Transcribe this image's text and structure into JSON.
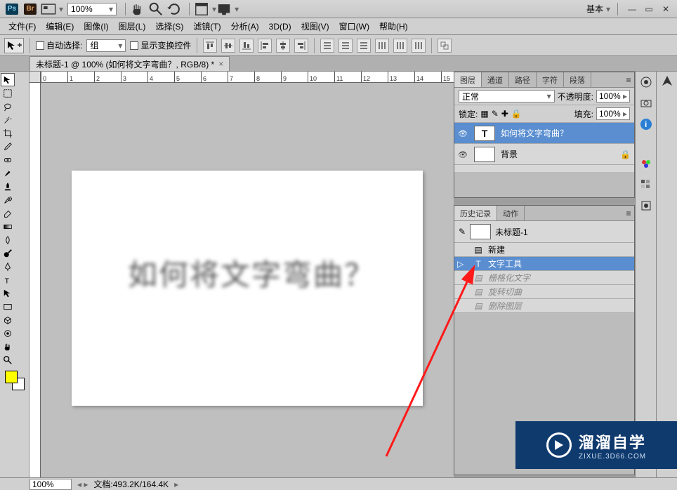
{
  "titlebar": {
    "zoom": "100%",
    "workspace": "基本",
    "ps": "Ps",
    "br": "Br"
  },
  "menu": {
    "file": "文件(F)",
    "edit": "编辑(E)",
    "image": "图像(I)",
    "layer": "图层(L)",
    "select": "选择(S)",
    "filter": "滤镜(T)",
    "analysis": "分析(A)",
    "threeD": "3D(D)",
    "view": "视图(V)",
    "window": "窗口(W)",
    "help": "帮助(H)"
  },
  "options": {
    "autoselect_label": "自动选择:",
    "autoselect_value": "组",
    "transform_controls": "显示变换控件"
  },
  "doc": {
    "tab_title": "未标题-1 @ 100% (如何将文字弯曲？, RGB/8) *",
    "canvas_text": "如何将文字弯曲？"
  },
  "ruler_ticks": [
    "0",
    "1",
    "2",
    "3",
    "4",
    "5",
    "6",
    "7",
    "8",
    "9",
    "10",
    "11",
    "12",
    "13",
    "14",
    "15"
  ],
  "layers_panel": {
    "tabs": {
      "layers": "图层",
      "channels": "通道",
      "paths": "路径",
      "character": "字符",
      "paragraph": "段落"
    },
    "blend_mode": "正常",
    "opacity_label": "不透明度:",
    "opacity_value": "100%",
    "lock_label": "锁定:",
    "fill_label": "填充:",
    "fill_value": "100%",
    "layers": [
      {
        "name": "如何将文字弯曲？",
        "type": "T",
        "selected": true
      },
      {
        "name": "背景",
        "type": "bg",
        "locked": true
      }
    ]
  },
  "history_panel": {
    "tabs": {
      "history": "历史记录",
      "actions": "动作"
    },
    "doc_name": "未标题-1",
    "items": [
      {
        "label": "新建",
        "state": "past"
      },
      {
        "label": "文字工具",
        "state": "current"
      },
      {
        "label": "栅格化文字",
        "state": "future"
      },
      {
        "label": "旋转切曲",
        "state": "future"
      },
      {
        "label": "删除图层",
        "state": "future"
      }
    ]
  },
  "status": {
    "zoom": "100%",
    "docinfo": "文档:493.2K/164.4K"
  },
  "watermark": {
    "brand": "溜溜自学",
    "url": "ZIXUE.3D66.COM"
  }
}
